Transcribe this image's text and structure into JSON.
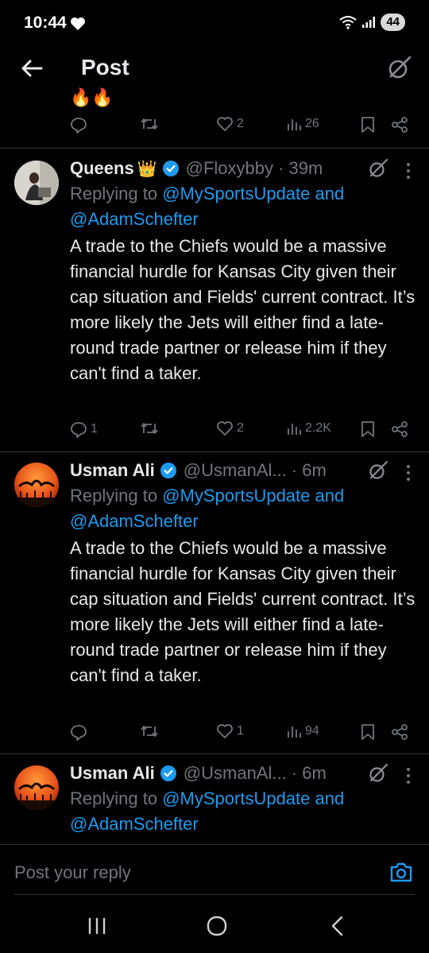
{
  "status_bar": {
    "time": "10:44",
    "battery": "44"
  },
  "header": {
    "title": "Post"
  },
  "top_tweet": {
    "emoji": "🔥🔥",
    "actions": {
      "replies": "",
      "reposts": "",
      "likes": "2",
      "views": "26"
    }
  },
  "tweets": [
    {
      "name": "Queens",
      "badge_emoji": "👑",
      "handle": "@Floxybby · 39m",
      "replying_prefix": "Replying to",
      "replying_mentions": "@MySportsUpdate and @AdamSchefter",
      "body": "A trade to the Chiefs would be a massive financial hurdle for Kansas City given their cap situation and Fields' current contract. It’s more likely the Jets will either find a late-round trade partner or release him if they can't find a taker.",
      "actions": {
        "replies": "1",
        "reposts": "",
        "likes": "2",
        "views": "2.2K"
      }
    },
    {
      "name": "Usman Ali",
      "badge_emoji": "",
      "handle": "@UsmanAl... · 6m",
      "replying_prefix": "Replying to",
      "replying_mentions": "@MySportsUpdate and @AdamSchefter",
      "body": "A trade to the Chiefs would be a massive financial hurdle for Kansas City given their cap situation and Fields' current contract. It’s more likely the Jets will either find a late-round trade partner or release him if they can't find a taker.",
      "actions": {
        "replies": "",
        "reposts": "",
        "likes": "1",
        "views": "94"
      }
    },
    {
      "name": "Usman Ali",
      "badge_emoji": "",
      "handle": "@UsmanAl... · 6m",
      "replying_prefix": "Replying to",
      "replying_mentions": "@MySportsUpdate and @AdamSchefter"
    }
  ],
  "reply_box": {
    "placeholder": "Post your reply"
  },
  "colors": {
    "background": "#000000",
    "text": "#e7e9ea",
    "muted": "#71767b",
    "accent": "#1d9bf0",
    "divider": "#2f3336"
  },
  "icons": [
    "back-arrow-icon",
    "grok-icon",
    "reply-icon",
    "repost-icon",
    "like-icon",
    "views-icon",
    "bookmark-icon",
    "share-icon",
    "verified-icon",
    "more-icon",
    "camera-icon"
  ]
}
